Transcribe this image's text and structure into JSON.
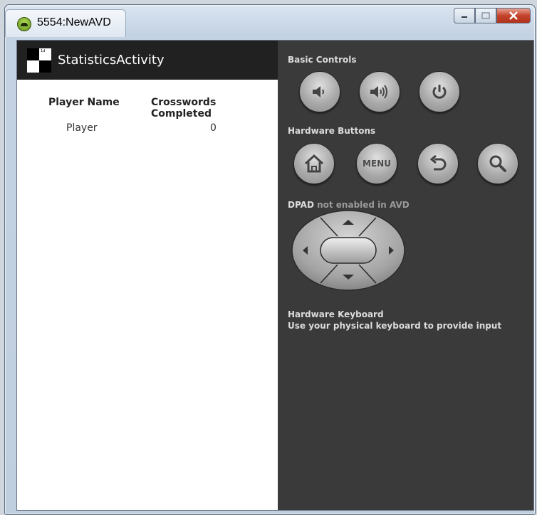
{
  "window": {
    "title": "5554:NewAVD"
  },
  "app": {
    "title": "StatisticsActivity",
    "table": {
      "headers": [
        "Player Name",
        "Crosswords Completed"
      ],
      "rows": [
        [
          "Player",
          "0"
        ]
      ]
    }
  },
  "controls": {
    "basic_label": "Basic Controls",
    "hardware_label": "Hardware Buttons",
    "dpad_label": "DPAD",
    "dpad_note": "not enabled in AVD",
    "menu_label": "MENU",
    "keyboard_title": "Hardware Keyboard",
    "keyboard_note": "Use your physical keyboard to provide input"
  },
  "icons": [
    "emulator-icon",
    "minimize-icon",
    "maximize-icon",
    "close-icon",
    "app-icon",
    "volume-down-icon",
    "volume-up-icon",
    "power-icon",
    "home-icon",
    "back-icon",
    "search-icon",
    "dpad-up-icon",
    "dpad-down-icon",
    "dpad-left-icon",
    "dpad-right-icon"
  ]
}
